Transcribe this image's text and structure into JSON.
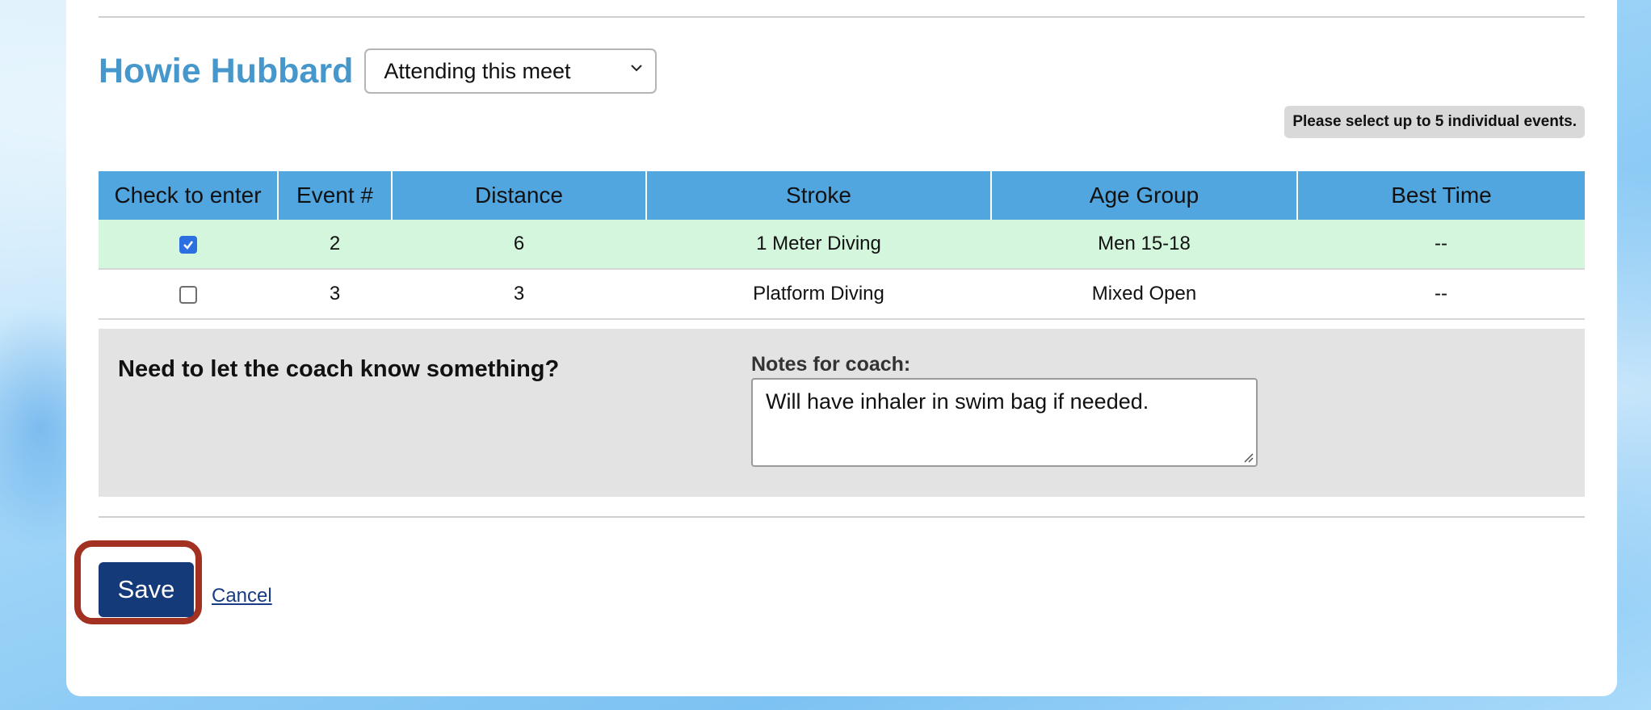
{
  "athlete": {
    "name": "Howie Hubbard",
    "attendance_selected": "Attending this meet"
  },
  "notice": {
    "text": "Please select up to 5 individual events."
  },
  "events_table": {
    "columns": [
      "Check to enter",
      "Event #",
      "Distance",
      "Stroke",
      "Age Group",
      "Best Time"
    ],
    "rows": [
      {
        "checked": true,
        "event_num": "2",
        "distance": "6",
        "stroke": "1 Meter Diving",
        "age_group": "Men 15-18",
        "best_time": "--"
      },
      {
        "checked": false,
        "event_num": "3",
        "distance": "3",
        "stroke": "Platform Diving",
        "age_group": "Mixed Open",
        "best_time": "--"
      }
    ],
    "selected_row_color": "#d3f6dc",
    "header_color": "#51a6e0"
  },
  "coach_notes": {
    "prompt": "Need to let the coach know something?",
    "label": "Notes for coach:",
    "value": "Will have inhaler in swim bag if needed."
  },
  "actions": {
    "save_label": "Save",
    "cancel_label": "Cancel",
    "save_color": "#153a7a",
    "highlight_color": "#a33122"
  },
  "theme": {
    "name_color": "#4697cc"
  }
}
